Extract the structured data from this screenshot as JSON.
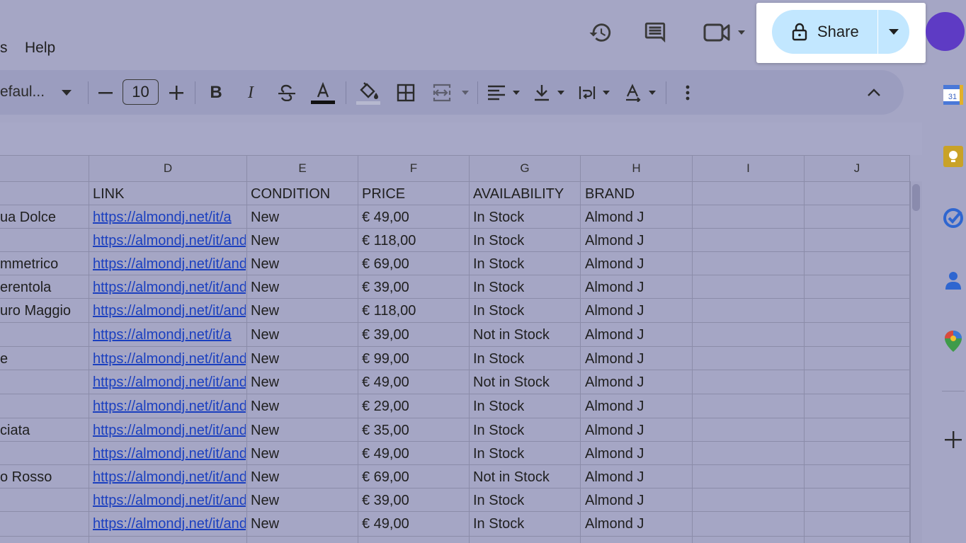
{
  "menu": {
    "partial_item": "s",
    "help": "Help"
  },
  "share": {
    "label": "Share"
  },
  "toolbar": {
    "font_name": "efaul...",
    "font_size": "10"
  },
  "columns": [
    "D",
    "E",
    "F",
    "G",
    "H",
    "I",
    "J"
  ],
  "header_row": {
    "link": "LINK",
    "condition": "CONDITION",
    "price": "PRICE",
    "availability": "AVAILABILITY",
    "brand": "BRAND"
  },
  "rows": [
    {
      "c": "ua Dolce",
      "link": "https://almondj.net/it/a",
      "condition": "New",
      "price": "€ 49,00",
      "availability": "In Stock",
      "brand": "Almond J"
    },
    {
      "c": "",
      "link": "https://almondj.net/it/and",
      "condition": "New",
      "price": "€ 118,00",
      "availability": "In Stock",
      "brand": "Almond J"
    },
    {
      "c": "mmetrico",
      "link": "https://almondj.net/it/and",
      "condition": "New",
      "price": "€ 69,00",
      "availability": "In Stock",
      "brand": "Almond J"
    },
    {
      "c": "erentola",
      "link": "https://almondj.net/it/and",
      "condition": "New",
      "price": "€ 39,00",
      "availability": "In Stock",
      "brand": "Almond J"
    },
    {
      "c": "uro Maggio",
      "link": "https://almondj.net/it/and",
      "condition": "New",
      "price": "€ 118,00",
      "availability": "In Stock",
      "brand": "Almond J"
    },
    {
      "c": "",
      "link": "https://almondj.net/it/a",
      "condition": "New",
      "price": "€ 39,00",
      "availability": "Not in Stock",
      "brand": "Almond J"
    },
    {
      "c": "e",
      "link": "https://almondj.net/it/and",
      "condition": "New",
      "price": "€ 99,00",
      "availability": "In Stock",
      "brand": "Almond J"
    },
    {
      "c": "",
      "link": "https://almondj.net/it/and",
      "condition": "New",
      "price": "€ 49,00",
      "availability": "Not in Stock",
      "brand": "Almond J"
    },
    {
      "c": "",
      "link": "https://almondj.net/it/and",
      "condition": "New",
      "price": "€ 29,00",
      "availability": "In Stock",
      "brand": "Almond J"
    },
    {
      "c": "ciata",
      "link": "https://almondj.net/it/and",
      "condition": "New",
      "price": "€ 35,00",
      "availability": "In Stock",
      "brand": "Almond J"
    },
    {
      "c": "",
      "link": "https://almondj.net/it/and",
      "condition": "New",
      "price": "€ 49,00",
      "availability": "In Stock",
      "brand": "Almond J"
    },
    {
      "c": "o Rosso",
      "link": "https://almondj.net/it/and",
      "condition": "New",
      "price": "€ 69,00",
      "availability": "Not in Stock",
      "brand": "Almond J"
    },
    {
      "c": "",
      "link": "https://almondj.net/it/and",
      "condition": "New",
      "price": "€ 39,00",
      "availability": "In Stock",
      "brand": "Almond J"
    },
    {
      "c": "",
      "link": "https://almondj.net/it/and",
      "condition": "New",
      "price": "€ 49,00",
      "availability": "In Stock",
      "brand": "Almond J"
    }
  ],
  "icons": {
    "history": "history-icon",
    "comments": "comment-icon",
    "meet": "video-camera-icon",
    "lock": "lock-icon",
    "calendar": "calendar-icon",
    "keep": "keep-icon",
    "tasks": "tasks-icon",
    "contacts": "contacts-icon",
    "maps": "maps-icon",
    "add": "plus-icon"
  },
  "colors": {
    "share_bg": "#c2e7ff",
    "avatar": "#5e3bc4",
    "link": "#1a3fbf",
    "overlay": "#a5a6c5"
  }
}
